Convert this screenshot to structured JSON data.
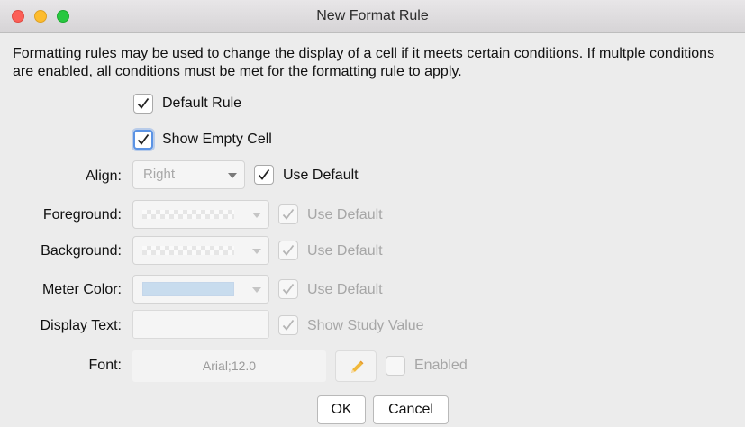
{
  "window": {
    "title": "New Format Rule"
  },
  "description": "Formatting rules may be used to change the display of a cell if it meets certain conditions.  If multple conditions are enabled, all conditions must be met for the formatting rule to apply.",
  "options": {
    "default_rule": {
      "label": "Default Rule",
      "checked": true
    },
    "show_empty_cell": {
      "label": "Show Empty Cell",
      "checked": true
    }
  },
  "align": {
    "label": "Align:",
    "value": "Right",
    "use_default_label": "Use Default"
  },
  "foreground": {
    "label": "Foreground:",
    "use_default_label": "Use Default"
  },
  "background": {
    "label": "Background:",
    "use_default_label": "Use Default"
  },
  "meter_color": {
    "label": "Meter Color:",
    "color": "#c8dcee",
    "use_default_label": "Use Default"
  },
  "display_text": {
    "label": "Display Text:",
    "value": "",
    "show_study_value_label": "Show Study Value"
  },
  "font": {
    "label": "Font:",
    "value": "Arial;12.0",
    "edit_icon": "pencil-icon",
    "enabled_label": "Enabled"
  },
  "buttons": {
    "ok": "OK",
    "cancel": "Cancel"
  },
  "colors": {
    "close": "#fc5f57",
    "minimize": "#fdbc2e",
    "maximize": "#28c840",
    "focus": "#5b93e4",
    "pencil": "#f0b83a"
  }
}
